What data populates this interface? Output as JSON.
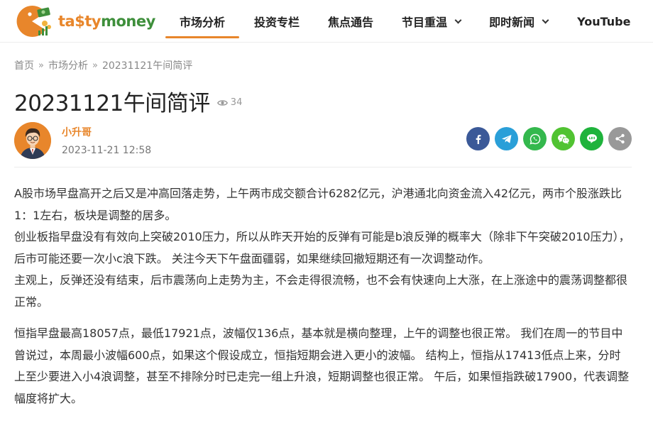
{
  "brand": {
    "logo_text_parts": [
      "ta",
      "$",
      "ty",
      "money"
    ],
    "colors": {
      "orange": "#e8862b",
      "green": "#3e8f3b"
    }
  },
  "nav": {
    "items": [
      {
        "label": "市场分析",
        "active": true,
        "dropdown": false
      },
      {
        "label": "投资专栏",
        "active": false,
        "dropdown": false
      },
      {
        "label": "焦点通告",
        "active": false,
        "dropdown": false
      },
      {
        "label": "节目重温",
        "active": false,
        "dropdown": true
      },
      {
        "label": "即时新闻",
        "active": false,
        "dropdown": true
      },
      {
        "label": "YouTube",
        "active": false,
        "dropdown": false
      }
    ]
  },
  "breadcrumb": {
    "home": "首页",
    "separator": "»",
    "category": "市场分析",
    "current": "20231121午间简评"
  },
  "post": {
    "title": "20231121午间简评",
    "views": "34",
    "author": "小升哥",
    "date": "2023-11-21 12:58"
  },
  "share": {
    "buttons": [
      {
        "name": "facebook",
        "icon": "facebook-icon",
        "color": "#3b5998"
      },
      {
        "name": "telegram",
        "icon": "telegram-icon",
        "color": "#2a9fd8"
      },
      {
        "name": "whatsapp",
        "icon": "whatsapp-icon",
        "color": "#34b84d"
      },
      {
        "name": "wechat",
        "icon": "wechat-icon",
        "color": "#51c332"
      },
      {
        "name": "line",
        "icon": "line-icon",
        "color": "#1fb33c"
      },
      {
        "name": "share",
        "icon": "share-icon",
        "color": "#999999"
      }
    ]
  },
  "article": {
    "paragraphs": [
      "A股市场早盘高开之后又是冲高回落走势，上午两市成交额合计6282亿元，沪港通北向资金流入42亿元，两市个股涨跌比1：1左右，板块是调整的居多。",
      "创业板指早盘没有有效向上突破2010压力，所以从昨天开始的反弹有可能是b浪反弹的概率大（除非下午突破2010压力），后市可能还要一次小c浪下跌。 关注今天下午盘面疆弱，如果继续回撤短期还有一次调整动作。",
      "主观上，反弹还没有结束，后市震荡向上走势为主，不会走得很流畅，也不会有快速向上大涨，在上涨途中的震荡调整都很正常。",
      "恒指早盘最高18057点，最低17921点，波幅仅136点，基本就是横向整理，上午的调整也很正常。 我们在周一的节目中曾说过，本周最小波幅600点，如果这个假设成立，恒指短期会进入更小的波幅。 结构上，恒指从17413低点上来，分时上至少要进入小4浪调整，甚至不排除分时已走完一组上升浪，短期调整也很正常。 午后，如果恒指跌破17900，代表调整幅度将扩大。"
    ]
  }
}
